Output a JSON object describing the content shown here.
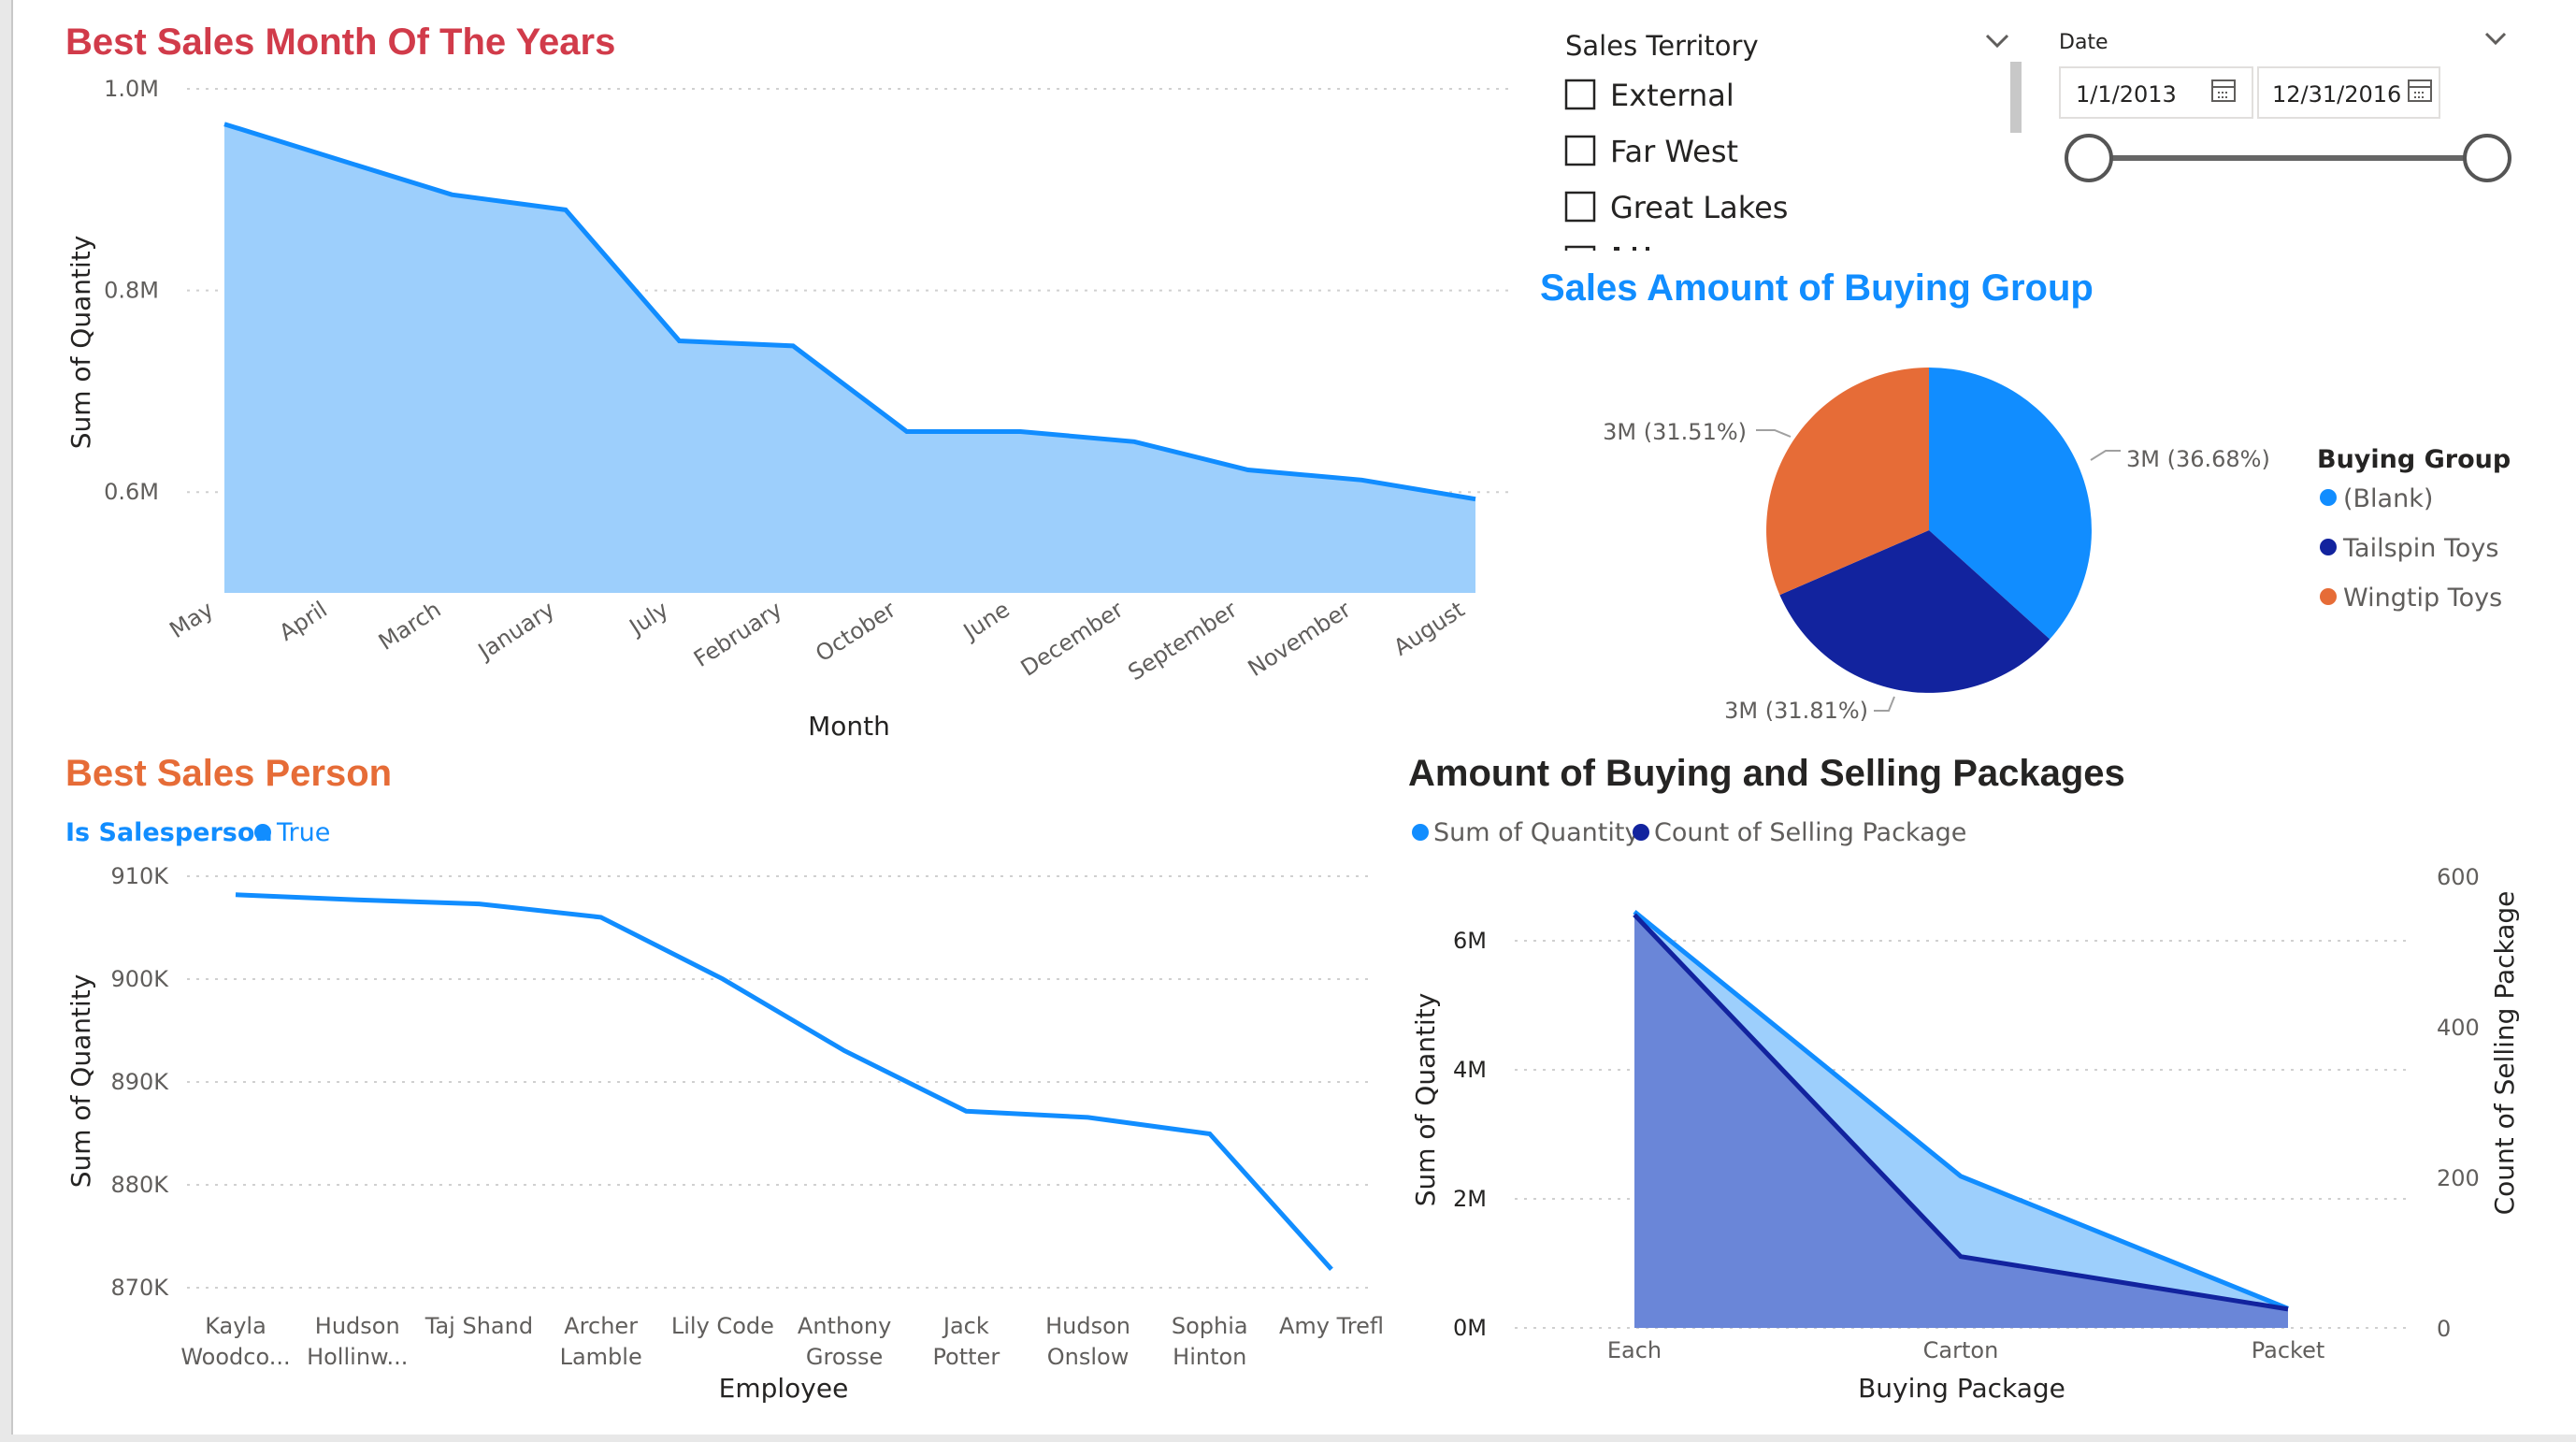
{
  "charts": {
    "months": {
      "title": "Best Sales Month Of The Years",
      "xlabel": "Month",
      "ylabel": "Sum of Quantity",
      "yticks": [
        "1.0M",
        "0.8M",
        "0.6M"
      ]
    },
    "salesperson": {
      "title": "Best Sales Person",
      "legend_label": "Is Salesperson",
      "legend_item": "True",
      "xlabel": "Employee",
      "ylabel": "Sum of Quantity",
      "yticks": [
        "910K",
        "900K",
        "890K",
        "880K",
        "870K"
      ],
      "categories": [
        [
          "Kayla",
          "Woodco..."
        ],
        [
          "Hudson",
          "Hollinw..."
        ],
        [
          "Taj Shand",
          ""
        ],
        [
          "Archer",
          "Lamble"
        ],
        [
          "Lily Code",
          ""
        ],
        [
          "Anthony",
          "Grosse"
        ],
        [
          "Jack",
          "Potter"
        ],
        [
          "Hudson",
          "Onslow"
        ],
        [
          "Sophia",
          "Hinton"
        ],
        [
          "Amy Trefl",
          ""
        ]
      ]
    },
    "buying_group": {
      "title": "Sales Amount of Buying Group",
      "legend_title": "Buying Group",
      "labels": [
        "3M (36.68%)",
        "3M (31.81%)",
        "3M (31.51%)"
      ]
    },
    "packages": {
      "title": "Amount of Buying and Selling Packages",
      "legend": [
        "Sum of Quantity",
        "Count of Selling Package"
      ],
      "xlabel": "Buying Package",
      "ylabel_left": "Sum of Quantity",
      "ylabel_right": "Count of Selling Package",
      "yticks_left": [
        "6M",
        "4M",
        "2M",
        "0M"
      ],
      "yticks_right": [
        "600",
        "400",
        "200",
        "0"
      ]
    }
  },
  "slicers": {
    "territory": {
      "title": "Sales Territory",
      "items": [
        "External",
        "Far West",
        "Great Lakes"
      ]
    },
    "date": {
      "title": "Date",
      "start": "1/1/2013",
      "end": "12/31/2016"
    }
  },
  "colors": {
    "blue": "#118dff",
    "light_blue": "#9dcffc",
    "navy": "#12239e",
    "orange": "#e66c37",
    "area_dark": "#6a86d8"
  },
  "chart_data": [
    {
      "type": "area",
      "title": "Best Sales Month Of The Years",
      "xlabel": "Month",
      "ylabel": "Sum of Quantity",
      "categories": [
        "May",
        "April",
        "March",
        "January",
        "July",
        "February",
        "October",
        "June",
        "December",
        "September",
        "November",
        "August"
      ],
      "values": [
        965000,
        930000,
        895000,
        880000,
        750000,
        745000,
        660000,
        660000,
        650000,
        622000,
        612000,
        593000
      ],
      "ylim": [
        500000,
        1000000
      ],
      "yticks": [
        600000,
        800000,
        1000000
      ]
    },
    {
      "type": "line",
      "title": "Best Sales Person",
      "xlabel": "Employee",
      "ylabel": "Sum of Quantity",
      "categories": [
        "Kayla Woodco...",
        "Hudson Hollinw...",
        "Taj Shand",
        "Archer Lamble",
        "Lily Code",
        "Anthony Grosse",
        "Jack Potter",
        "Hudson Onslow",
        "Sophia Hinton",
        "Amy Trefl"
      ],
      "series": [
        {
          "name": "True",
          "values": [
            908200,
            907700,
            907300,
            906000,
            900000,
            893000,
            887100,
            886500,
            884900,
            871700
          ]
        }
      ],
      "ylim": [
        870000,
        910000
      ]
    },
    {
      "type": "pie",
      "title": "Sales Amount of Buying Group",
      "categories": [
        "(Blank)",
        "Tailspin Toys",
        "Wingtip Toys"
      ],
      "values": [
        36.68,
        31.81,
        31.51
      ],
      "labels": [
        "3M (36.68%)",
        "3M (31.81%)",
        "3M (31.51%)"
      ],
      "legend": "right"
    },
    {
      "type": "area",
      "title": "Amount of Buying and Selling Packages",
      "xlabel": "Buying Package",
      "categories": [
        "Each",
        "Carton",
        "Packet"
      ],
      "series": [
        {
          "name": "Sum of Quantity",
          "axis": "left",
          "values": [
            6450000,
            2350000,
            300000
          ]
        },
        {
          "name": "Count of Selling Package",
          "axis": "right",
          "values": [
            550,
            95,
            25
          ]
        }
      ],
      "ylim_left": [
        0,
        7000000
      ],
      "ylim_right": [
        0,
        600
      ]
    }
  ]
}
